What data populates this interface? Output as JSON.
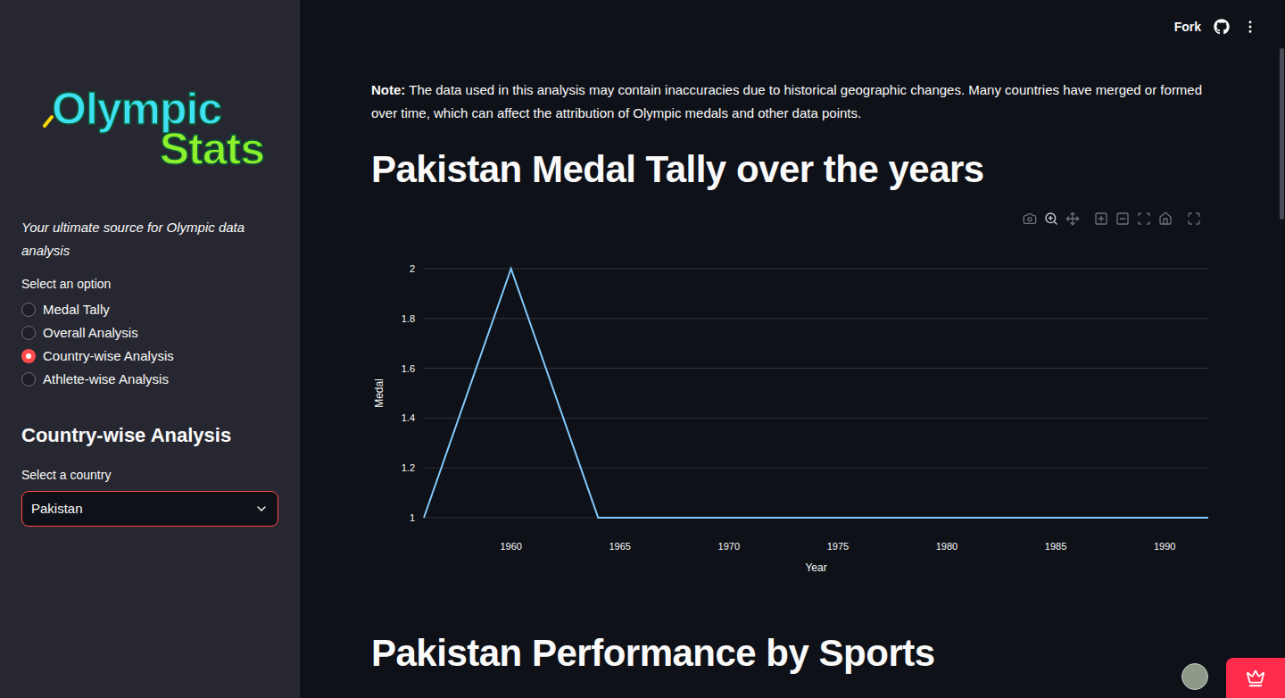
{
  "header": {
    "actions": [
      "Fork"
    ]
  },
  "sidebar": {
    "logo": {
      "line1": "Olympic",
      "line2": "Stats"
    },
    "tagline": "Your ultimate source for Olympic data analysis",
    "radio": {
      "label": "Select an option",
      "options": [
        {
          "label": "Medal Tally",
          "selected": false
        },
        {
          "label": "Overall Analysis",
          "selected": false
        },
        {
          "label": "Country-wise Analysis",
          "selected": true
        },
        {
          "label": "Athlete-wise Analysis",
          "selected": false
        }
      ]
    },
    "section_title": "Country-wise Analysis",
    "select": {
      "label": "Select a country",
      "value": "Pakistan"
    }
  },
  "main": {
    "note": {
      "label": "Note:",
      "text": "The data used in this analysis may contain inaccuracies due to historical geographic changes. Many countries have merged or formed over time, which can affect the attribution of Olympic medals and other data points."
    },
    "chart": {
      "title": "Pakistan Medal Tally over the years",
      "y_axis_title": "Medal",
      "x_axis_title": "Year",
      "y_ticks": [
        "1",
        "1.2",
        "1.4",
        "1.6",
        "1.8",
        "2"
      ],
      "x_ticks": [
        "1960",
        "1965",
        "1970",
        "1975",
        "1980",
        "1985",
        "1990"
      ],
      "series": [
        {
          "name": "Medal",
          "years": [
            1956,
            1960,
            1964,
            1968,
            1972,
            1976,
            1984,
            1988,
            1992
          ],
          "values": [
            1,
            2,
            1,
            1,
            1,
            1,
            1,
            1,
            1
          ]
        }
      ]
    },
    "next_section_title": "Pakistan Performance by Sports"
  }
}
